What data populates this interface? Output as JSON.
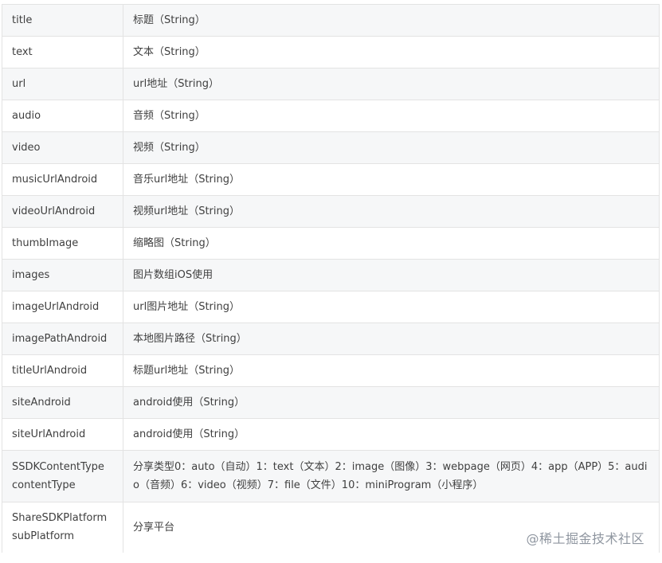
{
  "table": {
    "rows": [
      {
        "key": "title",
        "desc": "标题（String）"
      },
      {
        "key": "text",
        "desc": "文本（String）"
      },
      {
        "key": "url",
        "desc": "url地址（String）"
      },
      {
        "key": "audio",
        "desc": "音频（String）"
      },
      {
        "key": "video",
        "desc": "视频（String）"
      },
      {
        "key": "musicUrlAndroid",
        "desc": "音乐url地址（String）"
      },
      {
        "key": "videoUrlAndroid",
        "desc": "视频url地址（String）"
      },
      {
        "key": "thumbImage",
        "desc": "缩略图（String）"
      },
      {
        "key": "images",
        "desc": "图片数组iOS使用"
      },
      {
        "key": "imageUrlAndroid",
        "desc": "url图片地址（String）"
      },
      {
        "key": "imagePathAndroid",
        "desc": "本地图片路径（String）"
      },
      {
        "key": "titleUrlAndroid",
        "desc": "标题url地址（String）"
      },
      {
        "key": "siteAndroid",
        "desc": "android使用（String）"
      },
      {
        "key": "siteUrlAndroid",
        "desc": "android使用（String）"
      },
      {
        "key": "SSDKContentType contentType",
        "desc": "分享类型0：auto（自动）1：text（文本）2：image（图像）3：webpage（网页）4：app（APP）5：audio（音频）6：video（视频）7：file（文件）10：miniProgram（小程序）"
      },
      {
        "key": "ShareSDKPlatform subPlatform",
        "desc": "分享平台"
      }
    ]
  },
  "watermark": {
    "text": "@稀土掘金技术社区"
  }
}
